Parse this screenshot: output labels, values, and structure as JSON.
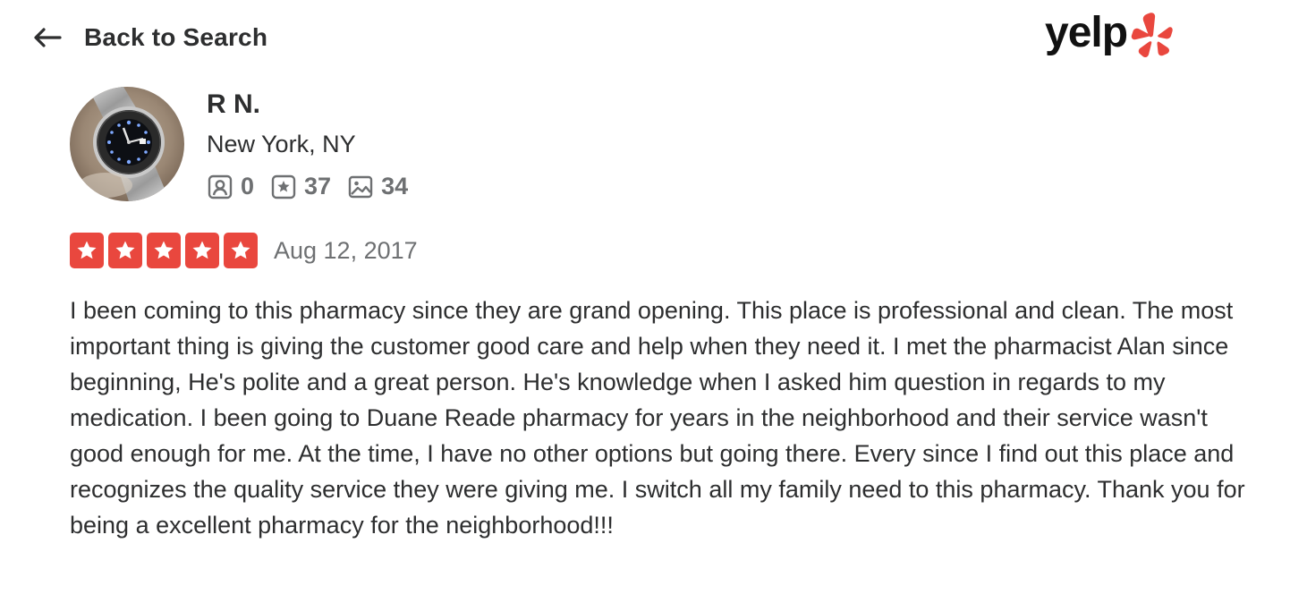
{
  "nav": {
    "back_label": "Back to Search"
  },
  "logo": {
    "text": "yelp",
    "accent_color": "#e9473e"
  },
  "user": {
    "name": "R N.",
    "location": "New York, NY",
    "stats": {
      "friends": "0",
      "reviews": "37",
      "photos": "34"
    }
  },
  "review": {
    "rating": 5,
    "star_color": "#e9473e",
    "date": "Aug 12, 2017",
    "text": "I been coming to this pharmacy since they are grand opening. This place is professional and clean. The most important thing is giving the customer good care and help when they need it. I met the pharmacist Alan since beginning, He's polite and a great person. He's knowledge when I asked him question in regards to my medication. I been going to Duane Reade pharmacy for years in the neighborhood and their service wasn't good enough for me. At the time, I have no other options but going there. Every since I find out this place and recognizes the quality service they were giving me. I switch all my family need to this pharmacy. Thank you for being a excellent pharmacy for the neighborhood!!!"
  }
}
